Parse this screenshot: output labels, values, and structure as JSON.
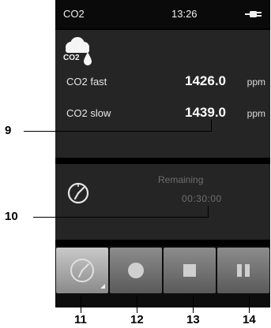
{
  "status_bar": {
    "title": "CO2",
    "time": "13:26",
    "icon": "power-plug-icon"
  },
  "measurements": {
    "icon": "co2-cloud-icon",
    "icon_text": "CO2",
    "rows": [
      {
        "label": "CO2 fast",
        "value": "1426.0",
        "unit": "ppm"
      },
      {
        "label": "CO2 slow",
        "value": "1439.0",
        "unit": "ppm"
      }
    ]
  },
  "timer": {
    "icon": "clock-icon",
    "label": "Remaining",
    "value": "00:30:00"
  },
  "toolbar": {
    "buttons": [
      {
        "name": "clock-settings-button",
        "icon": "clock-icon",
        "active": true
      },
      {
        "name": "record-button",
        "icon": "circle-icon"
      },
      {
        "name": "stop-button",
        "icon": "square-icon"
      },
      {
        "name": "pause-button",
        "icon": "pause-icon"
      }
    ]
  },
  "callouts": [
    "9",
    "10",
    "11",
    "12",
    "13",
    "14"
  ]
}
